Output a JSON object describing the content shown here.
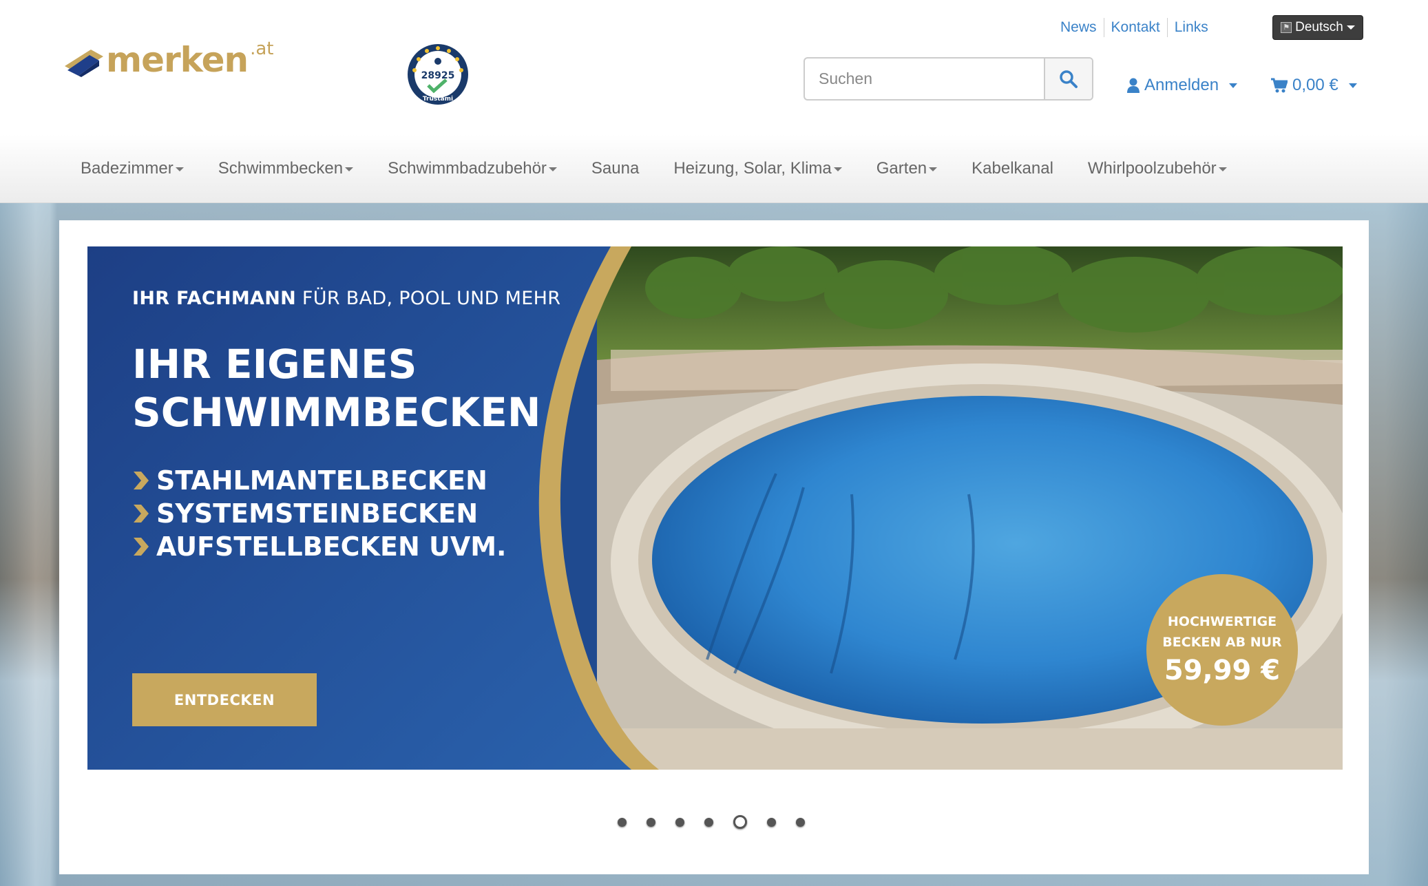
{
  "header": {
    "logo_text": "merken",
    "logo_tld": ".at",
    "trust_badge": {
      "number": "28925",
      "brand": "Trustami"
    },
    "top_links": [
      "News",
      "Kontakt",
      "Links"
    ],
    "language": "Deutsch",
    "search": {
      "placeholder": "Suchen"
    },
    "account_label": "Anmelden",
    "cart_label": "0,00 €"
  },
  "nav": {
    "items": [
      {
        "label": "Badezimmer",
        "dropdown": true
      },
      {
        "label": "Schwimmbecken",
        "dropdown": true
      },
      {
        "label": "Schwimmbadzubehör",
        "dropdown": true
      },
      {
        "label": "Sauna",
        "dropdown": false
      },
      {
        "label": "Heizung, Solar, Klima",
        "dropdown": true
      },
      {
        "label": "Garten",
        "dropdown": true
      },
      {
        "label": "Kabelkanal",
        "dropdown": false
      },
      {
        "label": "Whirlpoolzubehör",
        "dropdown": true
      }
    ]
  },
  "banner": {
    "kicker_bold": "IHR FACHMANN",
    "kicker_rest": " FÜR BAD, POOL UND MEHR",
    "headline_line1": "IHR EIGENES",
    "headline_line2": "SCHWIMMBECKEN",
    "features": [
      "STAHLMANTELBECKEN",
      "SYSTEMSTEINBECKEN",
      "AUFSTELLBECKEN UVM."
    ],
    "cta_label": "ENTDECKEN",
    "badge_line1": "HOCHWERTIGE",
    "badge_line2": "BECKEN AB NUR",
    "badge_price": "59,99 €"
  },
  "carousel": {
    "slide_count": 7,
    "active_slide": 5
  },
  "colors": {
    "link_blue": "#3a82c8",
    "gold": "#c8a85e",
    "banner_blue": "#1f4a8f",
    "nav_text": "#666666"
  },
  "icons": {
    "search": "search-icon",
    "account": "user-icon",
    "cart": "shopping-cart-icon",
    "language": "flag-icon",
    "feature_bullet": "chevron-right-icon"
  }
}
